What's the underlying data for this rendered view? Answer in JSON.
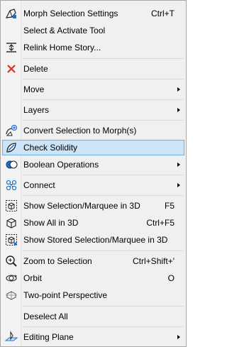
{
  "menu": {
    "items": [
      {
        "label": "Morph Selection Settings",
        "shortcut": "Ctrl+T",
        "icon": "morph-settings-icon"
      },
      {
        "label": "Select & Activate Tool",
        "icon": ""
      },
      {
        "label": "Relink Home Story...",
        "icon": "relink-story-icon"
      },
      {
        "label": "Delete",
        "icon": "delete-x-icon"
      },
      {
        "label": "Move",
        "submenu": true,
        "icon": ""
      },
      {
        "label": "Layers",
        "submenu": true,
        "icon": ""
      },
      {
        "label": "Convert Selection to Morph(s)",
        "icon": "convert-morph-icon"
      },
      {
        "label": "Check Solidity",
        "highlighted": true,
        "icon": "check-solidity-icon"
      },
      {
        "label": "Boolean Operations",
        "submenu": true,
        "icon": "boolean-icon"
      },
      {
        "label": "Connect",
        "submenu": true,
        "icon": "connect-icon"
      },
      {
        "label": "Show Selection/Marquee in 3D",
        "shortcut": "F5",
        "icon": "show-selection-3d-icon"
      },
      {
        "label": "Show All in 3D",
        "shortcut": "Ctrl+F5",
        "icon": "show-all-3d-icon"
      },
      {
        "label": "Show Stored Selection/Marquee in 3D",
        "icon": "show-stored-3d-icon"
      },
      {
        "label": "Zoom to Selection",
        "shortcut": "Ctrl+Shift+'",
        "icon": "zoom-selection-icon"
      },
      {
        "label": "Orbit",
        "shortcut": "O",
        "icon": "orbit-icon"
      },
      {
        "label": "Two-point Perspective",
        "icon": "two-point-perspective-icon"
      },
      {
        "label": "Deselect All",
        "icon": ""
      },
      {
        "label": "Editing Plane",
        "submenu": true,
        "icon": "editing-plane-icon"
      }
    ]
  },
  "colors": {
    "highlight_bg": "#cce4f7",
    "highlight_border": "#70aee0",
    "delete_red": "#e0302a",
    "icon_blue": "#1f6fd1"
  }
}
